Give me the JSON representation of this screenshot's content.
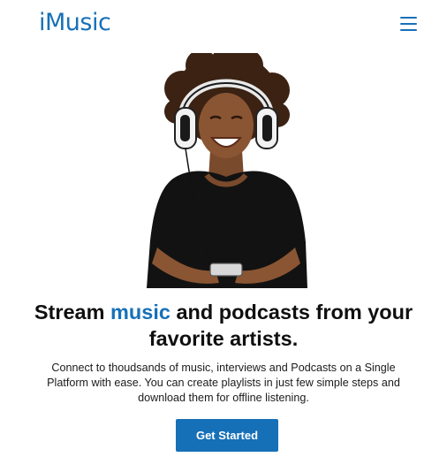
{
  "brand": {
    "logo_text": "iMusic",
    "accent_color": "#1670b8"
  },
  "header": {
    "menu_icon": "hamburger-menu-icon"
  },
  "hero": {
    "image_subject": "woman-with-headphones-holding-phone",
    "headline_part1": "Stream ",
    "headline_accent": "music",
    "headline_part2": " and podcasts from your favorite artists.",
    "description": "Connect to thoudsands of music, interviews and Podcasts on a Single Platform with ease. You can create playlists in just few simple steps and download them for offline listening.",
    "cta_label": "Get Started"
  }
}
